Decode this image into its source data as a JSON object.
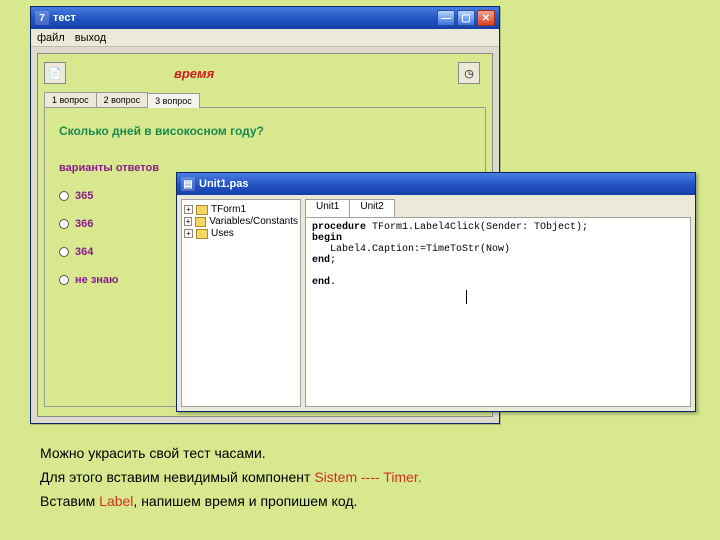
{
  "test_window": {
    "title": "тест",
    "icon_label": "7",
    "menu": {
      "file": "файл",
      "exit": "выход"
    },
    "time_label": "время",
    "tabs": [
      "1 вопрос",
      "2 вопрос",
      "3 вопрос"
    ],
    "active_tab": 2,
    "question": "Сколько дней в високосном году?",
    "variants_label": "варианты ответов",
    "answers": [
      "365",
      "366",
      "364",
      "не знаю"
    ]
  },
  "ide_window": {
    "title": "Unit1.pas",
    "tree": [
      "TForm1",
      "Variables/Constants",
      "Uses"
    ],
    "tabs": [
      "Unit1",
      "Unit2"
    ],
    "code": {
      "l1a": "procedure",
      "l1b": " TForm1.Label4Click(Sender: TObject);",
      "l2": "begin",
      "l3": "   Label4.Caption:=TimeToStr(Now)",
      "l4": "end",
      "l4b": ";",
      "l5": "end",
      "l5b": "."
    }
  },
  "explain": {
    "p1": "Можно украсить свой тест часами.",
    "p2a": "Для этого вставим невидимый компонент  ",
    "p2b": "Sistem ---- Timer.",
    "p3a": "Вставим  ",
    "p3b": "Label",
    "p3c": ", напишем время и пропишем код."
  }
}
